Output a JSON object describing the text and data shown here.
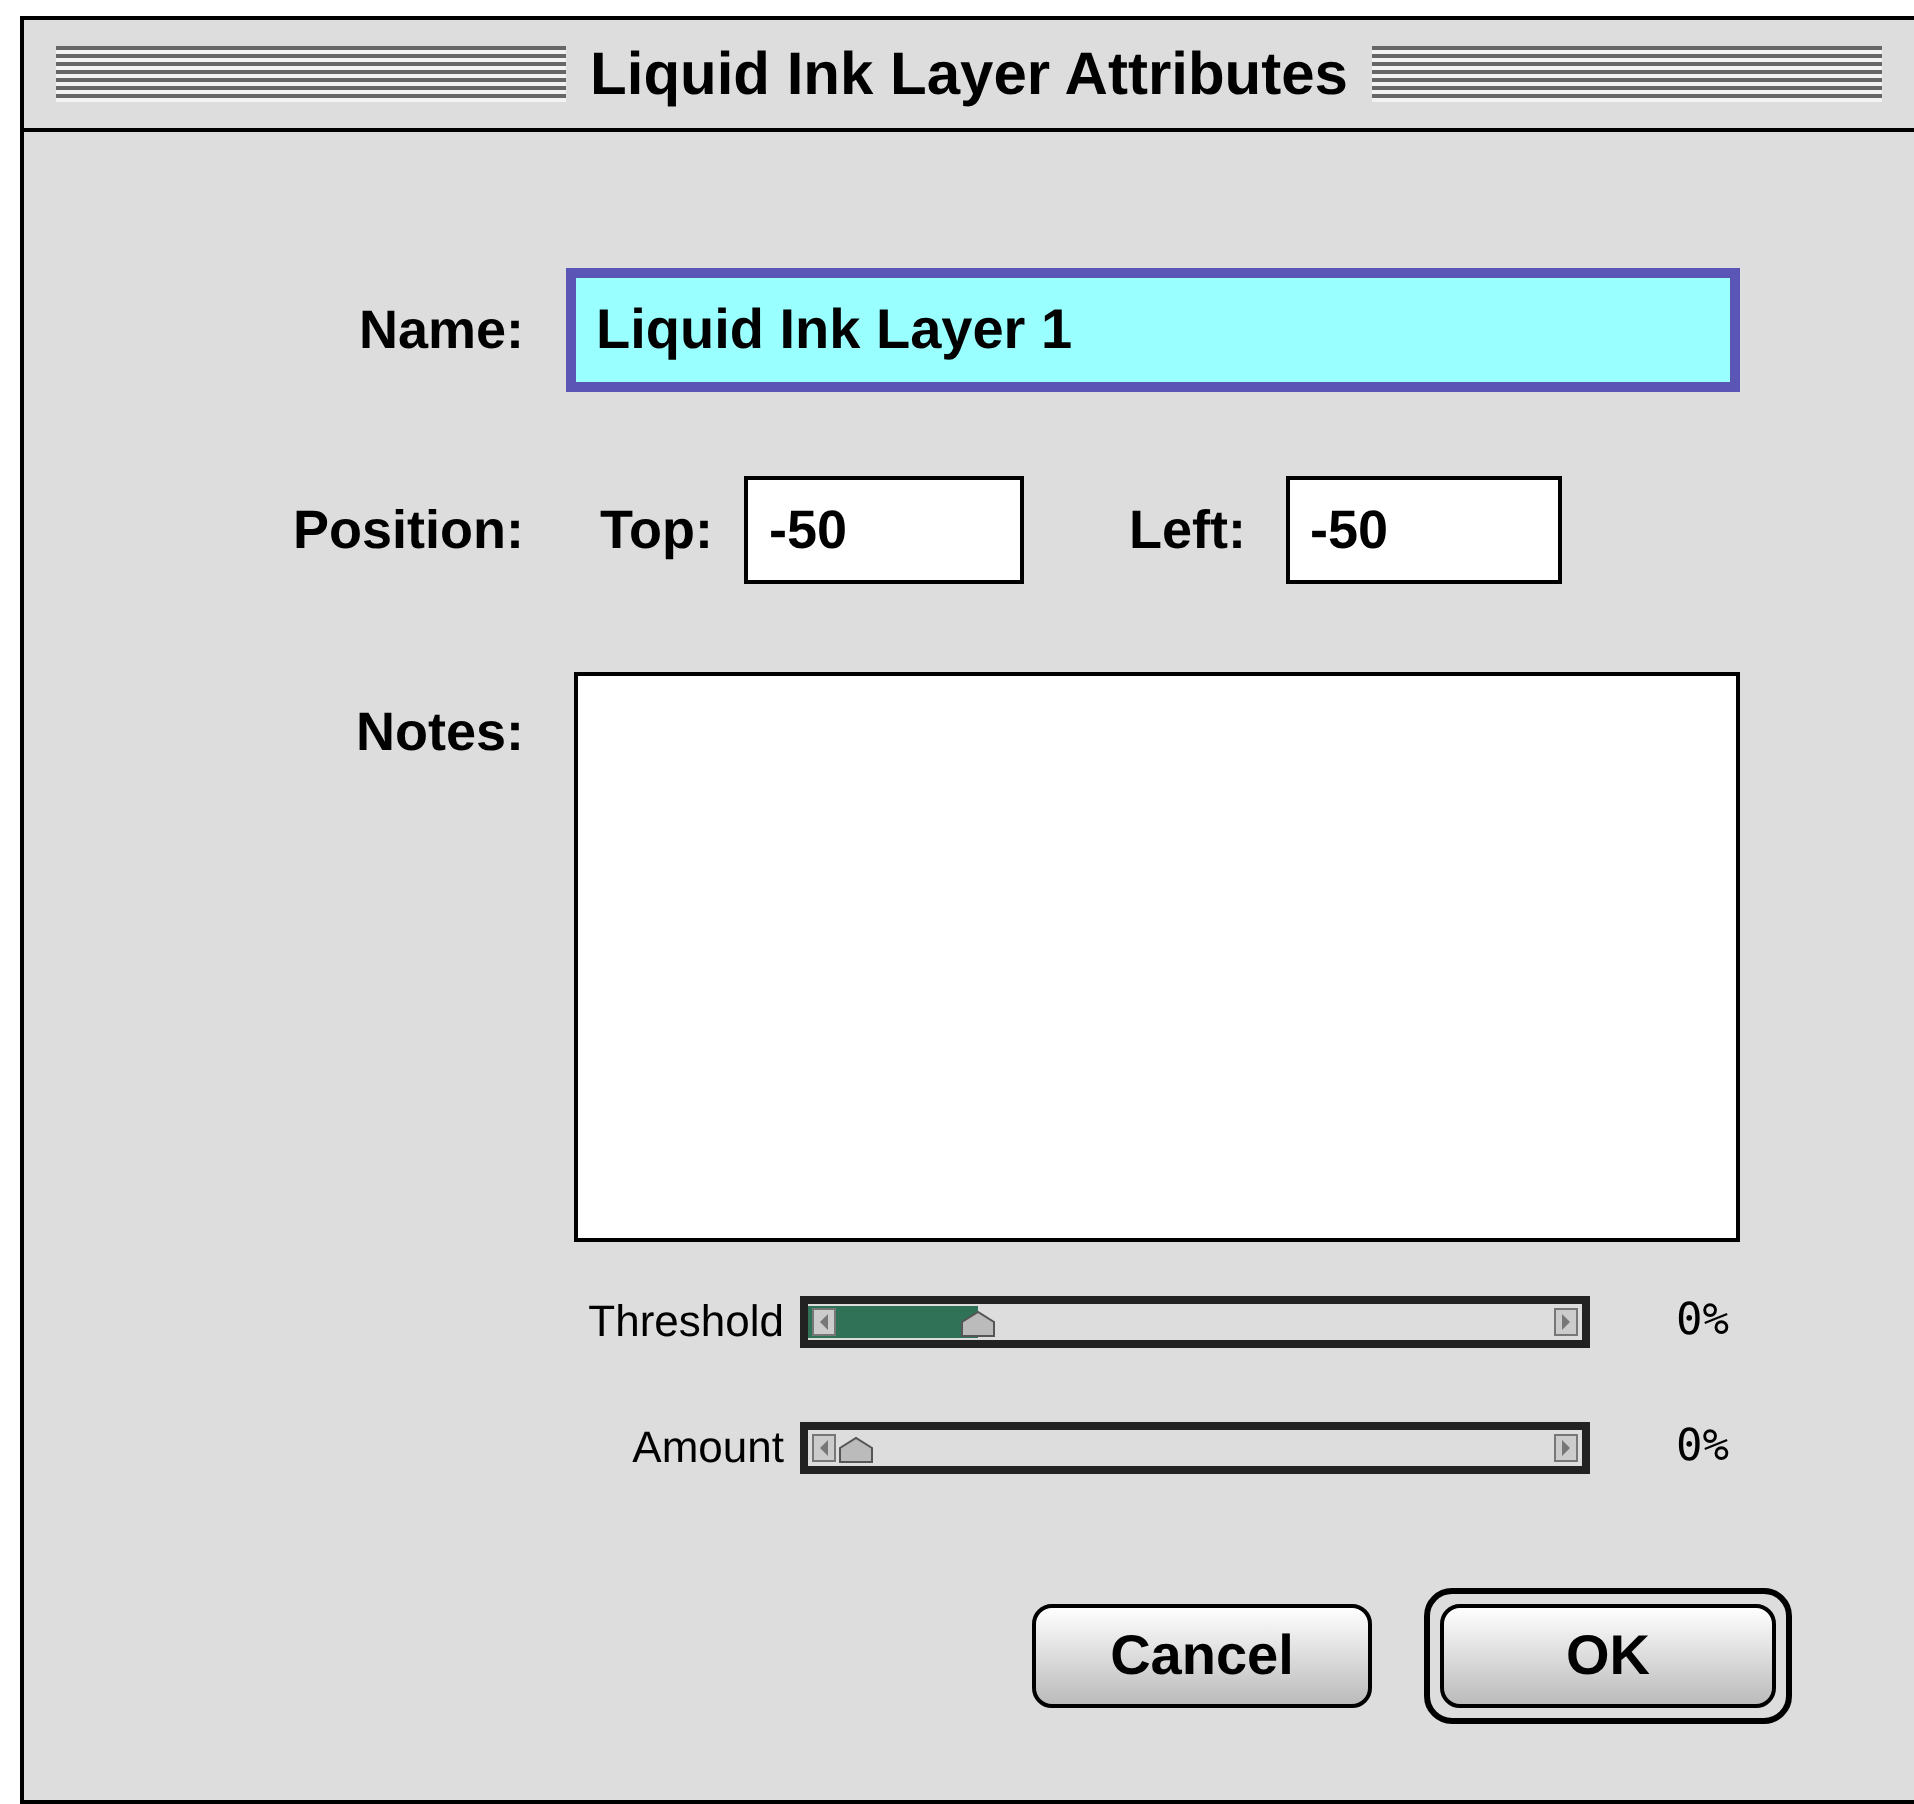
{
  "window": {
    "title": "Liquid Ink Layer Attributes"
  },
  "name": {
    "label": "Name:",
    "value": "Liquid Ink Layer 1",
    "focused": true
  },
  "position": {
    "label": "Position:",
    "top": {
      "label": "Top:",
      "value": "-50"
    },
    "left": {
      "label": "Left:",
      "value": "-50"
    }
  },
  "notes": {
    "label": "Notes:"
  },
  "sliders": [
    {
      "label": "Threshold",
      "level": 0.22,
      "reading": "0%"
    },
    {
      "label": "Amount",
      "level": 0,
      "reading": "0%"
    }
  ],
  "buttons": [
    {
      "label": "Cancel",
      "default": false
    },
    {
      "label": "OK",
      "default": true
    }
  ]
}
